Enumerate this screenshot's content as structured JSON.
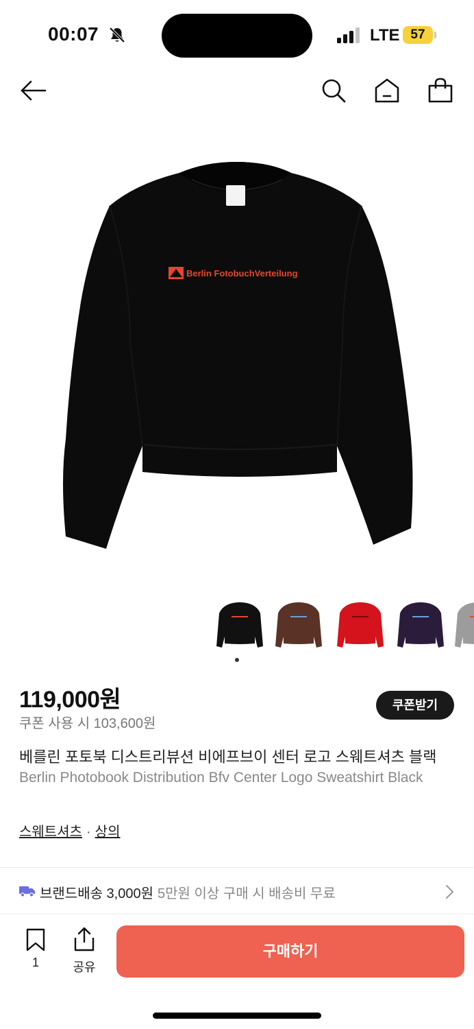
{
  "status_bar": {
    "time": "00:07",
    "network": "LTE",
    "battery": "57"
  },
  "product": {
    "print_text": "Berlin FotobuchVerteilung",
    "price": "119,000원",
    "coupon_price": "쿠폰 사용 시 103,600원",
    "coupon_button": "쿠폰받기",
    "title_ko": "베를린 포토북 디스트리뷰션 비에프브이 센터 로고 스웨트셔츠 블랙",
    "title_en": "Berlin Photobook Distribution Bfv Center Logo Sweatshirt Black"
  },
  "thumbnails": [
    {
      "color": "#111111",
      "active": true
    },
    {
      "color": "#5a3226",
      "active": false
    },
    {
      "color": "#d4131c",
      "active": false
    },
    {
      "color": "#2b1c3c",
      "active": false
    },
    {
      "color": "#9c9c9c",
      "active": false
    }
  ],
  "category": {
    "primary": "스웨트셔츠",
    "separator": "·",
    "secondary": "상의"
  },
  "shipping": {
    "label": "브랜드배송 3,000원",
    "condition": "5만원 이상 구매 시 배송비 무료"
  },
  "bottom_bar": {
    "bookmark_count": "1",
    "share_label": "공유",
    "buy_label": "구매하기"
  },
  "colors": {
    "accent": "#ef6150",
    "truck": "#6b6fe0",
    "battery": "#f6d13a"
  }
}
